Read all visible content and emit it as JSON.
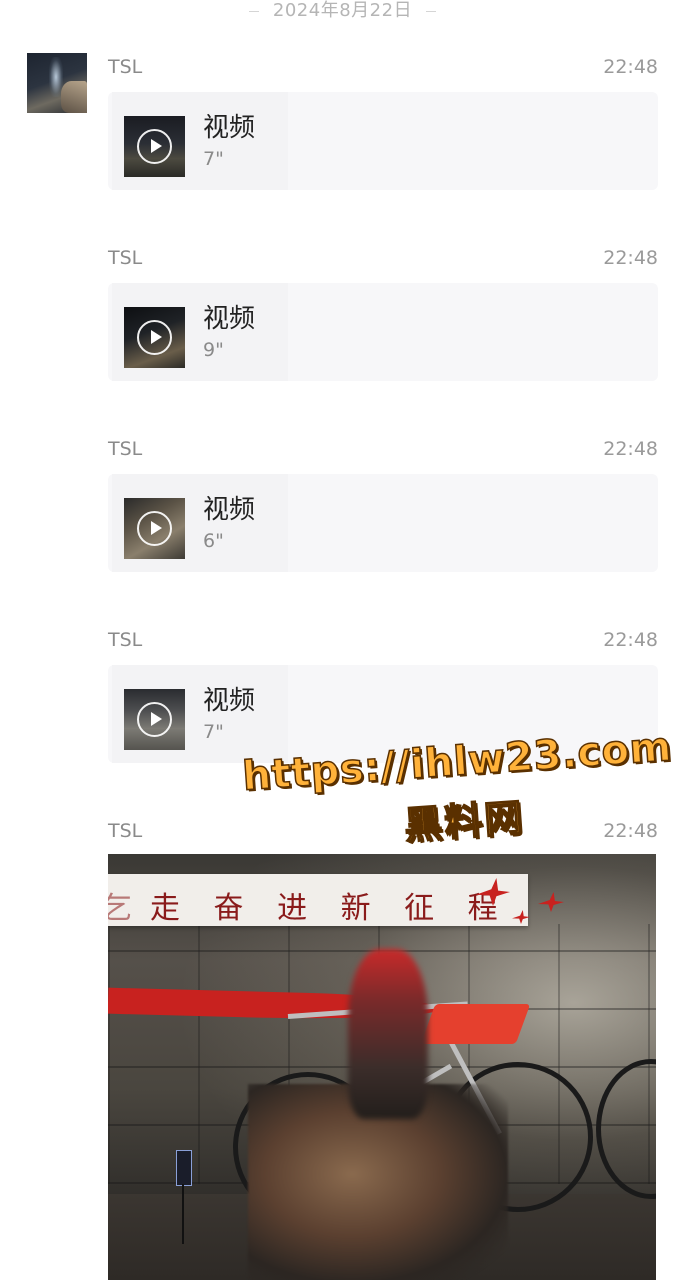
{
  "chat": {
    "date_divider": "2024年8月22日",
    "messages": [
      {
        "sender": "TSL",
        "time": "22:48",
        "type": "video",
        "label": "视频",
        "duration": "7\""
      },
      {
        "sender": "TSL",
        "time": "22:48",
        "type": "video",
        "label": "视频",
        "duration": "9\""
      },
      {
        "sender": "TSL",
        "time": "22:48",
        "type": "video",
        "label": "视频",
        "duration": "6\""
      },
      {
        "sender": "TSL",
        "time": "22:48",
        "type": "video",
        "label": "视频",
        "duration": "7\""
      },
      {
        "sender": "TSL",
        "time": "22:48",
        "type": "image"
      }
    ]
  },
  "photo": {
    "banner_text": "走 奋 进 新 征 程",
    "banner_text_prefix": "乞"
  },
  "watermark": {
    "url": "https://ihlw23.com",
    "name": "黑料网"
  },
  "colors": {
    "bubble_bg": "#f7f7f9",
    "meta_text": "#9a9a9a",
    "watermark_fill": "#ffb23a",
    "watermark_stroke": "#5a3000",
    "banner_text": "#8a1b1b",
    "ribbon_red": "#c8221f"
  },
  "icons": {
    "play": "play-circle-icon"
  }
}
